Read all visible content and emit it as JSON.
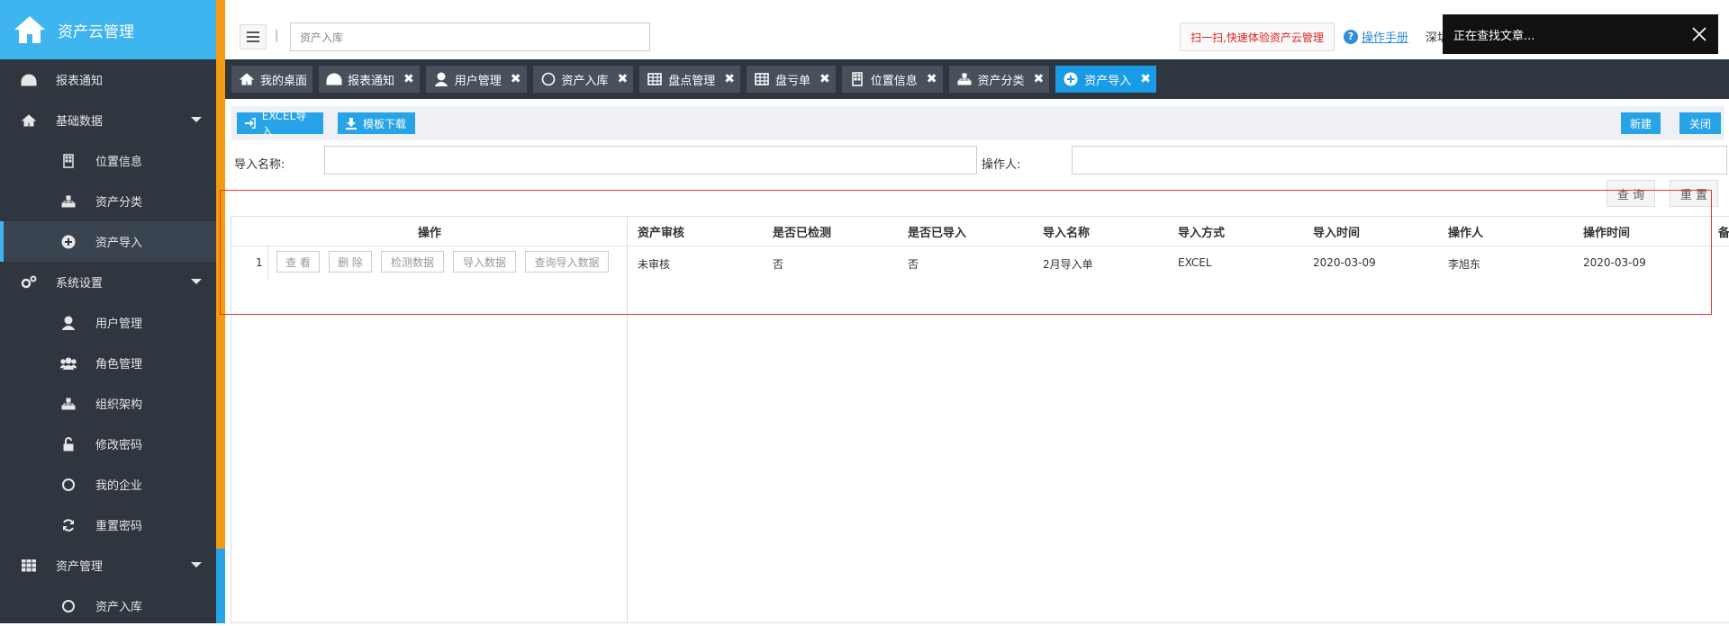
{
  "sidebar": {
    "brand_title": "资产云管理",
    "items": [
      {
        "label": "报表通知",
        "icon": "dashboard-icon",
        "level": 1
      },
      {
        "label": "基础数据",
        "icon": "home-icon",
        "level": 1,
        "expanded": true
      },
      {
        "label": "位置信息",
        "icon": "building-icon",
        "level": 2
      },
      {
        "label": "资产分类",
        "icon": "sitemap-icon",
        "level": 2
      },
      {
        "label": "资产导入",
        "icon": "plus-circle-icon",
        "level": 2,
        "active": true
      },
      {
        "label": "系统设置",
        "icon": "cogs-icon",
        "level": 1,
        "expanded": true
      },
      {
        "label": "用户管理",
        "icon": "user-icon",
        "level": 2
      },
      {
        "label": "角色管理",
        "icon": "users-icon",
        "level": 2
      },
      {
        "label": "组织架构",
        "icon": "sitemap-icon",
        "level": 2
      },
      {
        "label": "修改密码",
        "icon": "unlock-icon",
        "level": 2
      },
      {
        "label": "我的企业",
        "icon": "circle-icon",
        "level": 2
      },
      {
        "label": "重置密码",
        "icon": "refresh-icon",
        "level": 2
      },
      {
        "label": "资产管理",
        "icon": "grid-icon",
        "level": 1,
        "expanded": true
      },
      {
        "label": "资产入库",
        "icon": "circle-icon",
        "level": 2
      }
    ]
  },
  "topbar": {
    "search_value": "资产入库",
    "promo": "扫一扫,快速体验资产云管理",
    "help_label": "操作手册",
    "cut_text": "深圳",
    "toast": "正在查找文章..."
  },
  "tabs": [
    {
      "label": "我的桌面",
      "icon": "home-icon",
      "closable": false
    },
    {
      "label": "报表通知",
      "icon": "dashboard-icon",
      "closable": true
    },
    {
      "label": "用户管理",
      "icon": "user-icon",
      "closable": true
    },
    {
      "label": "资产入库",
      "icon": "circle-icon",
      "closable": true
    },
    {
      "label": "盘点管理",
      "icon": "table-icon",
      "closable": true
    },
    {
      "label": "盘亏单",
      "icon": "table-icon",
      "closable": true
    },
    {
      "label": "位置信息",
      "icon": "building-icon",
      "closable": true
    },
    {
      "label": "资产分类",
      "icon": "sitemap-icon",
      "closable": true
    },
    {
      "label": "资产导入",
      "icon": "plus-circle-icon",
      "closable": true,
      "active": true
    }
  ],
  "toolbar": {
    "excel_import": "EXCEL导入",
    "template_download": "模板下载",
    "new": "新建",
    "close": "关闭"
  },
  "search": {
    "name_label": "导入名称:",
    "operator_label": "操作人:",
    "query": "查 询",
    "reset": "重 置"
  },
  "table": {
    "ops_header": "操作",
    "columns": [
      "资产审核",
      "是否已检测",
      "是否已导入",
      "导入名称",
      "导入方式",
      "导入时间",
      "操作人",
      "操作时间",
      "备"
    ],
    "rows": [
      {
        "index": "1",
        "actions": [
          "查 看",
          "删 除",
          "检测数据",
          "导入数据",
          "查询导入数据"
        ],
        "cells": [
          "未审核",
          "否",
          "否",
          "2月导入单",
          "EXCEL",
          "2020-03-09",
          "李旭东",
          "2020-03-09",
          ""
        ]
      }
    ]
  },
  "colors": {
    "accent": "#27a4e8",
    "brand": "#3fb5f0",
    "sidebar": "#2f3640",
    "strip": "#f39c12",
    "highlight_box": "#e53935"
  }
}
